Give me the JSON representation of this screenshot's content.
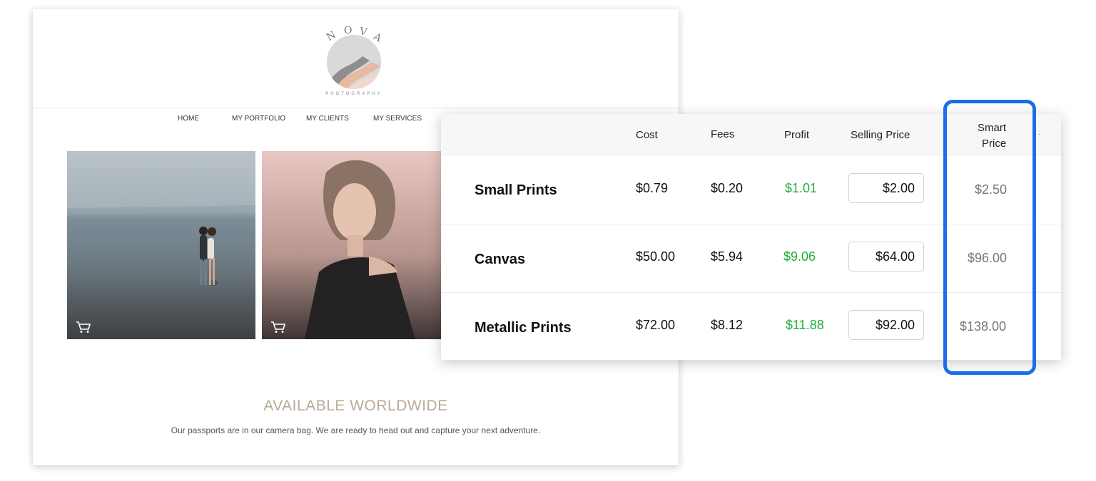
{
  "website": {
    "logo": {
      "letters": [
        "N",
        "O",
        "V",
        "A"
      ],
      "subtitle": "PHOTOGRAPHY",
      "colors": [
        "#d9d9d9",
        "#8e8e8e",
        "#e8b9a3",
        "#f3d8cc"
      ]
    },
    "nav": [
      "HOME",
      "MY PORTFOLIO",
      "MY CLIENTS",
      "MY SERVICES"
    ],
    "photos": [
      {
        "name": "couple-beach-photo",
        "cart_icon": "cart-icon"
      },
      {
        "name": "woman-portrait-photo",
        "cart_icon": "cart-icon"
      }
    ],
    "headline": "AVAILABLE WORLDWIDE",
    "tagline": "Our passports are in our camera bag.  We are ready to head out and capture your next adventure."
  },
  "pricing": {
    "headers": {
      "cost": "Cost",
      "fees": "Fees",
      "profit": "Profit",
      "selling_price": "Selling Price",
      "smart_price_line1": "Smart",
      "smart_price_line2": "Price"
    },
    "rows": [
      {
        "name": "Small Prints",
        "cost": "$0.79",
        "fees": "$0.20",
        "profit": "$1.01",
        "selling_price": "$2.00",
        "smart_price": "$2.50"
      },
      {
        "name": "Canvas",
        "cost": "$50.00",
        "fees": "$5.94",
        "profit": "$9.06",
        "selling_price": "$64.00",
        "smart_price": "$96.00"
      },
      {
        "name": "Metallic Prints",
        "cost": "$72.00",
        "fees": "$8.12",
        "profit": "$11.88",
        "selling_price": "$92.00",
        "smart_price": "$138.00"
      }
    ],
    "colors": {
      "profit": "#1fae3b",
      "highlight": "#1a6ee8",
      "smart_price": "#777777"
    }
  }
}
